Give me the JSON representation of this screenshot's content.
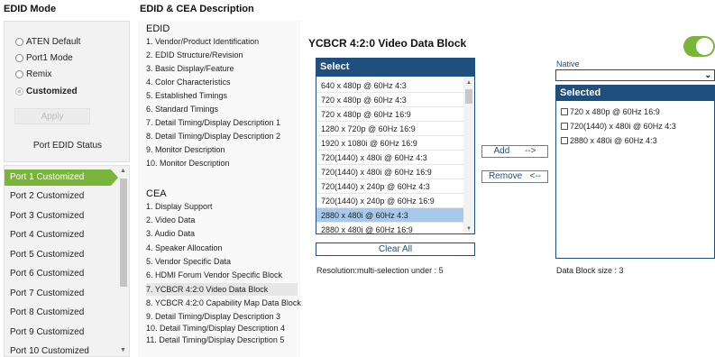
{
  "headers": {
    "edid_mode": "EDID Mode",
    "edid_cea": "EDID & CEA Description"
  },
  "mode": {
    "options": [
      {
        "label": "ATEN Default",
        "checked": false
      },
      {
        "label": "Port1 Mode",
        "checked": false
      },
      {
        "label": "Remix",
        "checked": false
      },
      {
        "label": "Customized",
        "checked": true
      }
    ],
    "apply_label": "Apply",
    "status_label": "Port EDID Status"
  },
  "ports": [
    "Port 1  Customized",
    "Port 2  Customized",
    "Port 3  Customized",
    "Port 4  Customized",
    "Port 5  Customized",
    "Port 6  Customized",
    "Port 7  Customized",
    "Port 8  Customized",
    "Port 9  Customized",
    "Port 10  Customized"
  ],
  "edid_section": {
    "title": "EDID",
    "items": [
      "1.   Vendor/Product Identification",
      "2.   EDID Structure/Revision",
      "3.   Basic Display/Feature",
      "4.   Color Characteristics",
      "5.   Established Timings",
      "6.   Standard Timings",
      "7.   Detail Timing/Display Description 1",
      "8.   Detail Timing/Display Description 2",
      "9.   Monitor Description",
      "10.   Monitor Description"
    ]
  },
  "cea_section": {
    "title": "CEA",
    "items": [
      "1.   Display Support",
      "2.   Video Data",
      "3.   Audio Data",
      "4.   Speaker Allocation",
      "5.   Vendor Specific Data",
      "6.   HDMI Forum Vendor Specific Block",
      "7.   YCBCR 4:2:0 Video Data Block",
      "8.   YCBCR 4:2:0 Capability Map Data Block",
      "9.   Detail Timing/Display Description 3",
      "10.   Detail Timing/Display Description 4",
      "11.   Detail Timing/Display Description 5"
    ]
  },
  "block": {
    "title": "YCBCR 4:2:0 Video Data Block",
    "select_header": "Select",
    "select_options": [
      "640 x 480p @ 60Hz 4:3",
      "720 x 480p @ 60Hz 4:3",
      "720 x 480p @ 60Hz 16:9",
      "1280 x 720p @ 60Hz 16:9",
      "1920 x 1080i @ 60Hz 16:9",
      "720(1440) x 480i @ 60Hz 4:3",
      "720(1440) x 480i @ 60Hz 16:9",
      "720(1440) x 240p @ 60Hz 4:3",
      "720(1440) x 240p @ 60Hz 16:9",
      "2880 x 480i @ 60Hz 4:3",
      "2880 x 480i @ 60Hz 16:9"
    ],
    "add_label": "Add",
    "add_arrow": "-->",
    "remove_label": "Remove",
    "remove_arrow": "<--",
    "clear_label": "Clear All",
    "resolution_note": "Resolution:multi-selection under : 5",
    "native_label": "Native",
    "native_value": "",
    "selected_header": "Selected",
    "selected_items": [
      "720 x 480p @ 60Hz 16:9",
      "720(1440) x 480i @ 60Hz 4:3",
      "2880 x 480i @ 60Hz 4:3"
    ],
    "block_size": "Data Block size : 3",
    "toggle_on": true
  }
}
